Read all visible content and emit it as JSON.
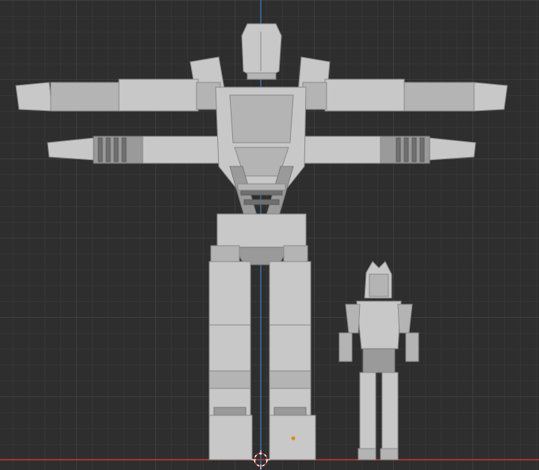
{
  "viewport": {
    "view": "front-orthographic",
    "grid": true,
    "colors": {
      "background": "#2e2e2e",
      "grid_major": "#3d3d3d",
      "grid_minor": "#353535",
      "axis_x": "#c0392b",
      "axis_z": "#3a6ea5",
      "mesh": "#b4b4b4",
      "origin_dot": "#e08a1e"
    }
  },
  "objects": [
    {
      "name": "large-robot",
      "icon": "mesh-icon"
    },
    {
      "name": "small-robot",
      "icon": "mesh-icon"
    }
  ],
  "cursor_3d": {
    "icon": "crosshair-icon"
  }
}
